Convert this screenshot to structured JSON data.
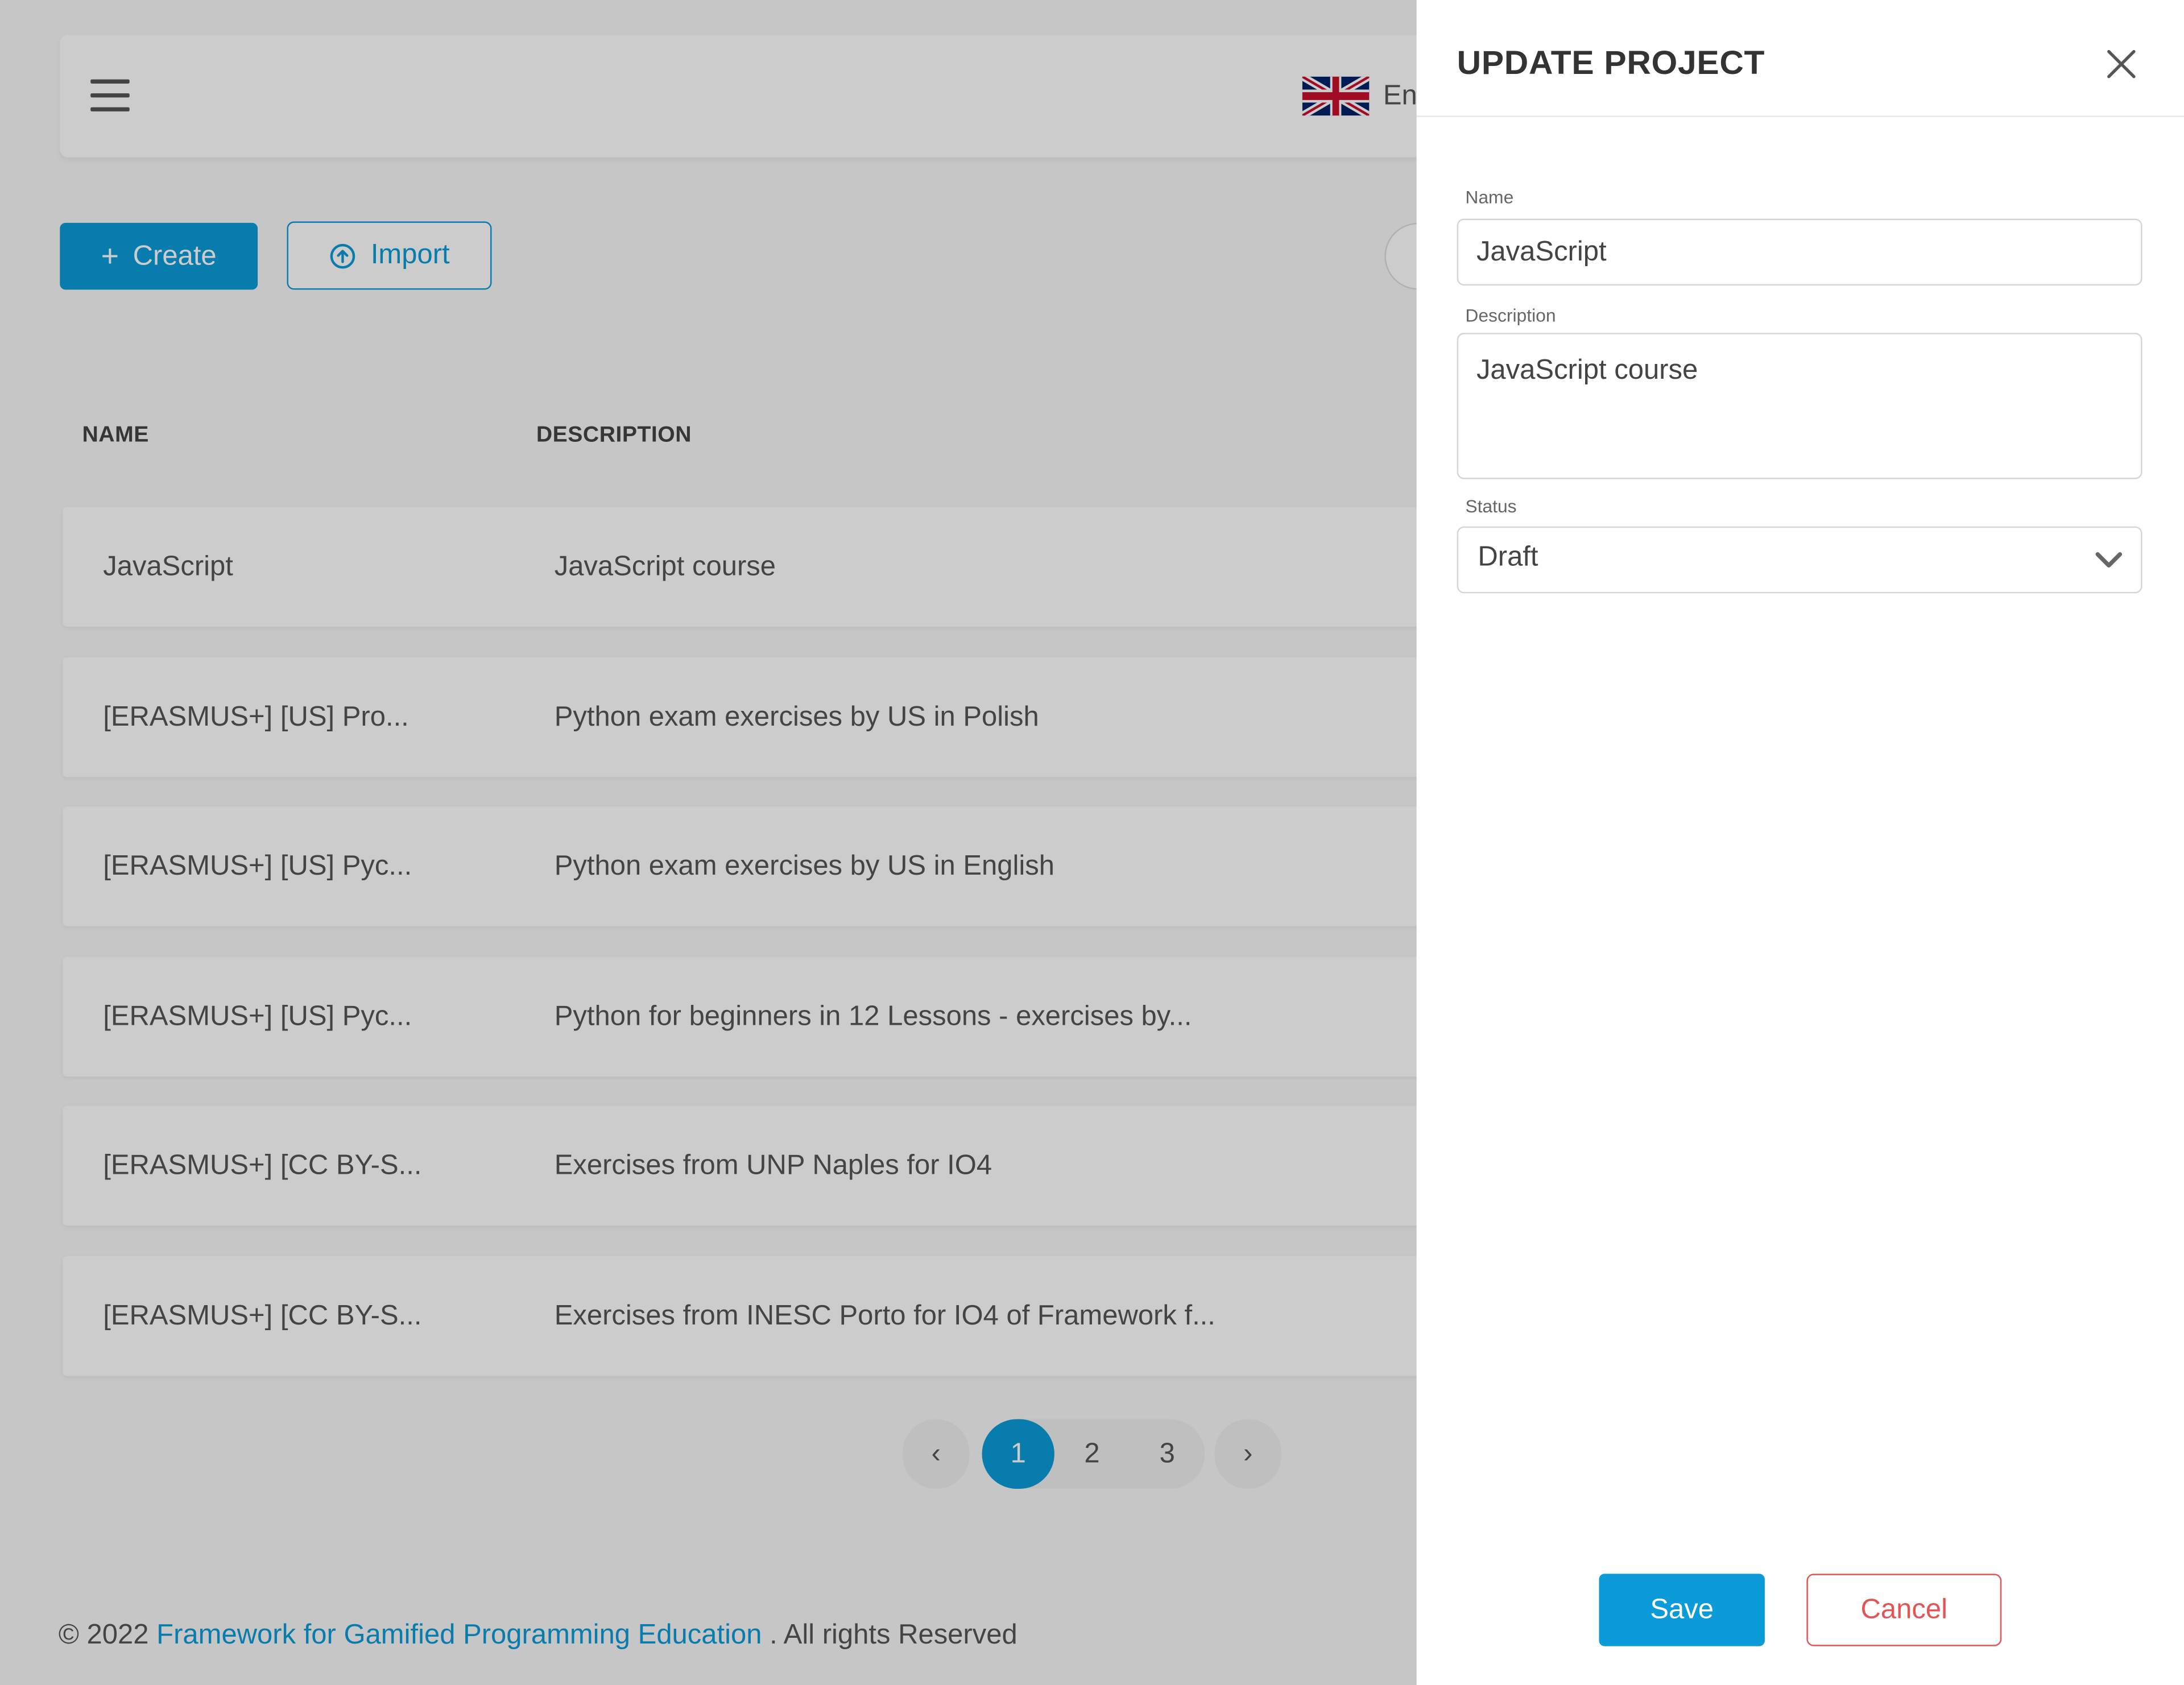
{
  "topbar": {
    "language": "En"
  },
  "toolbar": {
    "create_label": "Create",
    "import_label": "Import"
  },
  "table": {
    "headers": [
      "NAME",
      "DESCRIPTION"
    ],
    "rows": [
      {
        "name": "JavaScript",
        "description": "JavaScript course"
      },
      {
        "name": "[ERASMUS+] [US] Pro...",
        "description": "Python exam exercises by US in Polish"
      },
      {
        "name": "[ERASMUS+] [US] Pyc...",
        "description": "Python exam exercises by US in English"
      },
      {
        "name": "[ERASMUS+] [US] Pyc...",
        "description": "Python for beginners in 12 Lessons - exercises by..."
      },
      {
        "name": "[ERASMUS+] [CC BY-S...",
        "description": "Exercises from UNP Naples for IO4"
      },
      {
        "name": "[ERASMUS+] [CC BY-S...",
        "description": "Exercises from INESC Porto for IO4 of Framework f..."
      }
    ]
  },
  "pagination": {
    "prev": "‹",
    "next": "›",
    "pages": [
      "1",
      "2",
      "3"
    ],
    "current": "1"
  },
  "footer": {
    "prefix": "© 2022",
    "link": "Framework for Gamified Programming Education",
    "suffix": ". All rights Reserved"
  },
  "drawer": {
    "title": "UPDATE PROJECT",
    "fields": {
      "name_label": "Name",
      "name_value": "JavaScript",
      "description_label": "Description",
      "description_value": "JavaScript course",
      "status_label": "Status",
      "status_value": "Draft"
    },
    "save_label": "Save",
    "cancel_label": "Cancel"
  },
  "colors": {
    "primary": "#0a9bd8",
    "danger": "#e05555",
    "overlay": "rgba(0,0,0,0.2)"
  }
}
